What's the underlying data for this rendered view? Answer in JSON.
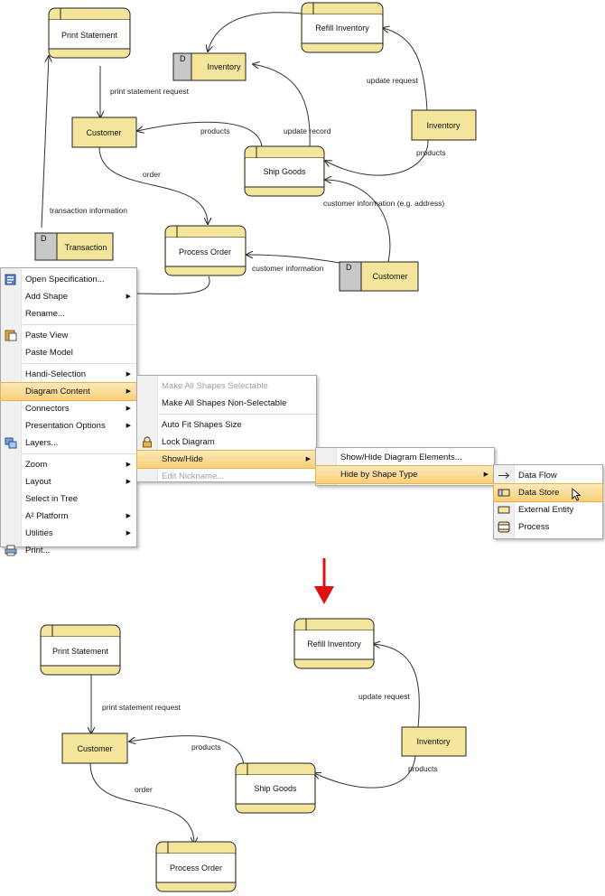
{
  "top_diagram": {
    "processes": {
      "print_statement": "Print Statement",
      "refill_inventory": "Refill Inventory",
      "ship_goods": "Ship Goods",
      "process_order": "Process Order"
    },
    "entities": {
      "customer": "Customer",
      "inventory": "Inventory"
    },
    "stores": {
      "inventory": {
        "id": "D",
        "name": "Inventory"
      },
      "transaction": {
        "id": "D",
        "name": "Transaction"
      },
      "customer": {
        "id": "D",
        "name": "Customer"
      }
    },
    "flows": {
      "print_statement_request": "print statement request",
      "update_request": "update request",
      "products_left": "products",
      "update_record": "update record",
      "products_right": "products",
      "order": "order",
      "transaction_information": "transaction information",
      "customer_information_address": "customer information (e.g. address)",
      "customer_information": "customer information"
    }
  },
  "context_menu": {
    "items": [
      {
        "label": "Open Specification..."
      },
      {
        "label": "Add Shape"
      },
      {
        "label": "Rename..."
      },
      {
        "label": "Paste View"
      },
      {
        "label": "Paste Model"
      },
      {
        "label": "Handi-Selection"
      },
      {
        "label": "Diagram Content"
      },
      {
        "label": "Connectors"
      },
      {
        "label": "Presentation Options"
      },
      {
        "label": "Layers..."
      },
      {
        "label": "Zoom"
      },
      {
        "label": "Layout"
      },
      {
        "label": "Select in Tree"
      },
      {
        "label": "A² Platform"
      },
      {
        "label": "Utilities"
      },
      {
        "label": "Print..."
      }
    ]
  },
  "submenu_diagram_content": {
    "items": [
      {
        "label": "Make All Shapes Selectable"
      },
      {
        "label": "Make All Shapes Non-Selectable"
      },
      {
        "label": "Auto Fit Shapes Size"
      },
      {
        "label": "Lock Diagram"
      },
      {
        "label": "Show/Hide"
      },
      {
        "label": "Edit Nickname..."
      }
    ]
  },
  "submenu_show_hide": {
    "items": [
      {
        "label": "Show/Hide Diagram Elements..."
      },
      {
        "label": "Hide by Shape Type"
      }
    ]
  },
  "submenu_shape_type": {
    "items": [
      {
        "label": "Data Flow"
      },
      {
        "label": "Data Store"
      },
      {
        "label": "External Entity"
      },
      {
        "label": "Process"
      }
    ]
  },
  "bottom_diagram": {
    "processes": {
      "print_statement": "Print Statement",
      "refill_inventory": "Refill Inventory",
      "ship_goods": "Ship Goods",
      "process_order": "Process Order"
    },
    "entities": {
      "customer": "Customer",
      "inventory": "Inventory"
    },
    "flows": {
      "print_statement_request": "print statement request",
      "update_request": "update request",
      "products_left": "products",
      "products_right": "products",
      "order": "order"
    }
  },
  "colors": {
    "shape_fill": "#f4e59c",
    "store_id_fill": "#c8c8c8",
    "menu_highlight": "#f9d07a",
    "arrow_red": "#e01010"
  }
}
